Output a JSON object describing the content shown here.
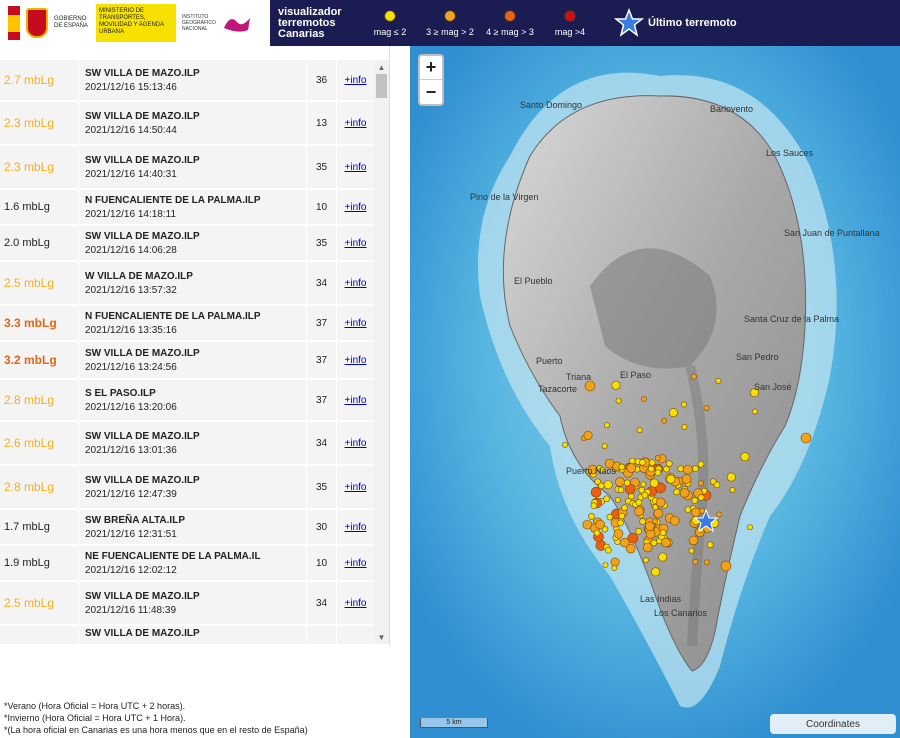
{
  "header": {
    "ministry_text": "GOBIERNO DE ESPAÑA",
    "ministry_text2": "MINISTERIO DE TRANSPORTES, MOVILIDAD Y AGENDA URBANA",
    "ign_text": "INSTITUTO GEOGRÁFICO NACIONAL",
    "app_title": "visualizador terremotos Canarias",
    "legend": [
      {
        "label": "mag ≤ 2",
        "color": "#f5e000"
      },
      {
        "label": "3 ≥ mag > 2",
        "color": "#f2a11a"
      },
      {
        "label": "4 ≥ mag > 3",
        "color": "#ec5e10"
      },
      {
        "label": "mag >4",
        "color": "#d01010"
      }
    ],
    "last_eq_label": "Último terremoto",
    "star_color": "#3a7de0"
  },
  "events": [
    {
      "mag": "2.7 mbLg",
      "cls": "mag-mid",
      "loc": "SW VILLA DE MAZO.ILP",
      "date": "2021/12/16 15:13:46",
      "num": "36",
      "info": "+info",
      "h": 42
    },
    {
      "mag": "2.3 mbLg",
      "cls": "mag-mid",
      "loc": "SW VILLA DE MAZO.ILP",
      "date": "2021/12/16 14:50:44",
      "num": "13",
      "info": "+info",
      "h": 44
    },
    {
      "mag": "2.3 mbLg",
      "cls": "mag-mid",
      "loc": "SW VILLA DE MAZO.ILP",
      "date": "2021/12/16 14:40:31",
      "num": "35",
      "info": "+info",
      "h": 44
    },
    {
      "mag": "1.6 mbLg",
      "cls": "mag-small",
      "loc": "N FUENCALIENTE DE LA PALMA.ILP",
      "date": "2021/12/16 14:18:11",
      "num": "10",
      "info": "+info",
      "h": 36
    },
    {
      "mag": "2.0 mbLg",
      "cls": "mag-small",
      "loc": "SW VILLA DE MAZO.ILP",
      "date": "2021/12/16 14:06:28",
      "num": "35",
      "info": "+info",
      "h": 36
    },
    {
      "mag": "2.5 mbLg",
      "cls": "mag-mid",
      "loc": "W VILLA DE MAZO.ILP",
      "date": "2021/12/16 13:57:32",
      "num": "34",
      "info": "+info",
      "h": 44
    },
    {
      "mag": "3.3 mbLg",
      "cls": "mag-big",
      "loc": "N FUENCALIENTE DE LA PALMA.ILP",
      "date": "2021/12/16 13:35:16",
      "num": "37",
      "info": "+info",
      "h": 36
    },
    {
      "mag": "3.2 mbLg",
      "cls": "mag-big",
      "loc": "SW VILLA DE MAZO.ILP",
      "date": "2021/12/16 13:24:56",
      "num": "37",
      "info": "+info",
      "h": 38
    },
    {
      "mag": "2.8 mbLg",
      "cls": "mag-mid",
      "loc": "S EL PASO.ILP",
      "date": "2021/12/16 13:20:06",
      "num": "37",
      "info": "+info",
      "h": 42
    },
    {
      "mag": "2.6 mbLg",
      "cls": "mag-mid",
      "loc": "SW VILLA DE MAZO.ILP",
      "date": "2021/12/16 13:01:36",
      "num": "34",
      "info": "+info",
      "h": 44
    },
    {
      "mag": "2.8 mbLg",
      "cls": "mag-mid",
      "loc": "SW VILLA DE MAZO.ILP",
      "date": "2021/12/16 12:47:39",
      "num": "35",
      "info": "+info",
      "h": 44
    },
    {
      "mag": "1.7 mbLg",
      "cls": "mag-small",
      "loc": "SW BREÑA ALTA.ILP",
      "date": "2021/12/16 12:31:51",
      "num": "30",
      "info": "+info",
      "h": 36
    },
    {
      "mag": "1.9 mbLg",
      "cls": "mag-small",
      "loc": "NE FUENCALIENTE DE LA PALMA.IL",
      "date": "2021/12/16 12:02:12",
      "num": "10",
      "info": "+info",
      "h": 36
    },
    {
      "mag": "2.5 mbLg",
      "cls": "mag-mid",
      "loc": "SW VILLA DE MAZO.ILP",
      "date": "2021/12/16 11:48:39",
      "num": "34",
      "info": "+info",
      "h": 44
    },
    {
      "mag": "",
      "cls": "mag-mid",
      "loc": "SW VILLA DE MAZO.ILP",
      "date": "",
      "num": "",
      "info": "",
      "h": 20
    }
  ],
  "footnotes": [
    "*Verano (Hora Oficial = Hora UTC + 2 horas).",
    "*Invierno (Hora Oficial = Hora UTC + 1 Hora).",
    "*(La hora oficial en Canarias es una hora menos que en el resto de España)"
  ],
  "map": {
    "zoom_in": "+",
    "zoom_out": "−",
    "scale_label": "5 km",
    "coordinates_label": "Coordinates",
    "places": [
      "Santo Domingo",
      "Barlovento",
      "Los Sauces",
      "Pino de la Virgen",
      "San Juan de Puntallana",
      "El Pueblo",
      "Santa Cruz de la Palma",
      "San Pedro",
      "Puerto",
      "Triana",
      "El Paso",
      "Tazacorte",
      "San José",
      "Puerto Naos",
      "Las Indias",
      "Los Canarios"
    ]
  }
}
